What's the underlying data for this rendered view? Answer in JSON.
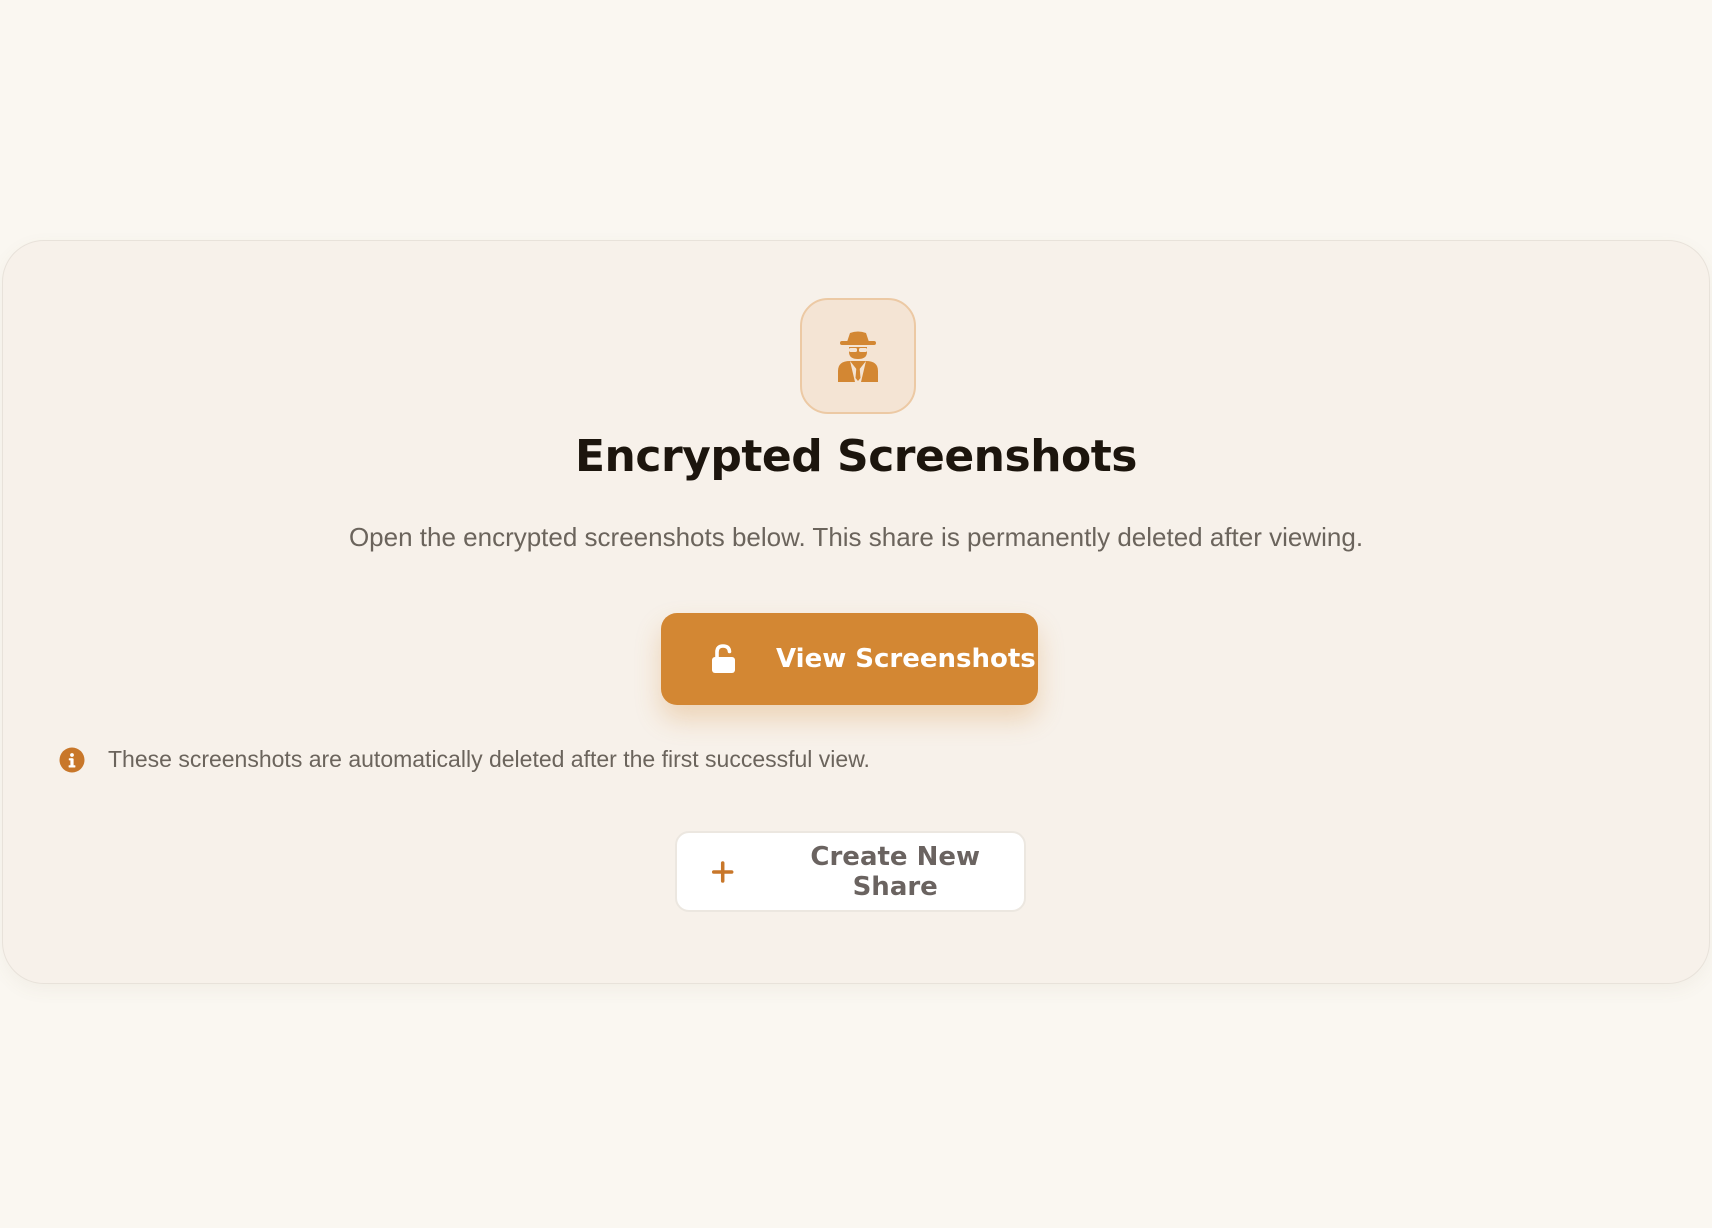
{
  "card": {
    "icon": "incognito-spy-icon",
    "title": "Encrypted Screenshots",
    "subtitle": "Open the encrypted screenshots below. This share is permanently deleted after viewing."
  },
  "actions": {
    "view": {
      "icon": "unlock-icon",
      "label": "View Screenshots"
    },
    "create": {
      "icon": "plus-icon",
      "label": "Create New Share"
    }
  },
  "notice": {
    "icon": "info-icon",
    "text": "These screenshots are automatically deleted after the first successful view."
  },
  "colors": {
    "page_background": "#faf7f1",
    "card_background": "#f7f1ea",
    "accent": "#d38733",
    "title_text": "#1c150d",
    "body_text": "#6b645c",
    "info_icon": "#c8772a"
  }
}
